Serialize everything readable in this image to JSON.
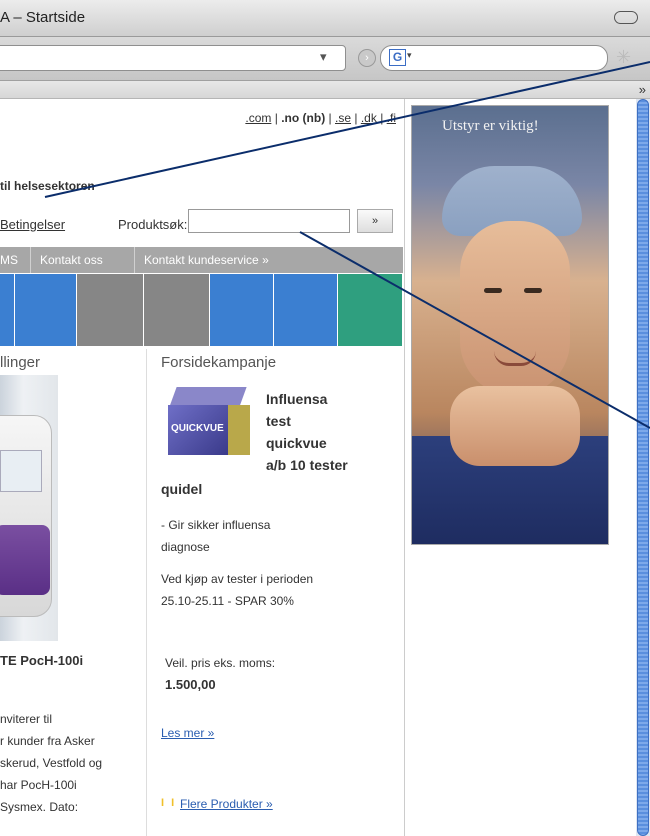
{
  "browser": {
    "window_title": "A – Startside",
    "bookmarks_overflow": "»",
    "url_dropdown": "▾",
    "search_icon_letter": "G",
    "search_caret": "▾"
  },
  "site": {
    "top_links": [
      ".com",
      ".no (nb)",
      ".se",
      ".dk",
      ".fi"
    ],
    "tagline": "til helsesektoren",
    "terms_link": "Betingelser",
    "product_search_label": "Produktsøk:",
    "product_search_button": "»",
    "nav": [
      "MS",
      "Kontakt oss",
      "Kontakt kundeservice »"
    ],
    "color_blocks": [
      "#3b7fd1",
      "#3b7fd1",
      "#868686",
      "#868686",
      "#3b7fd1",
      "#3b7fd1",
      "#2f9f7f"
    ]
  },
  "left_column": {
    "heading": "llinger",
    "product_name": "TE PocH-100i",
    "text_lines": [
      "nviterer til",
      "r kunder fra Asker",
      "skerud, Vestfold og",
      "har PocH-100i",
      "Sysmex. Dato:"
    ]
  },
  "campaign": {
    "heading": "Forsidekampanje",
    "box_label": "QUICKVUE",
    "title_lines": [
      "Influensa",
      "test",
      "quickvue",
      "a/b 10 tester"
    ],
    "brand": "quidel",
    "desc_lines": [
      "- Gir sikker influensa",
      "diagnose"
    ],
    "offer_lines": [
      "Ved kjøp av tester i perioden",
      "25.10-25.11 - SPAR 30%"
    ],
    "price_label": "Veil. pris eks. moms:",
    "price": "1.500,00",
    "read_more": "Les mer »",
    "more_products": "Flere Produkter »",
    "bullet_glyphs": "I I"
  },
  "ad": {
    "caption": "Utstyr er viktig!"
  }
}
